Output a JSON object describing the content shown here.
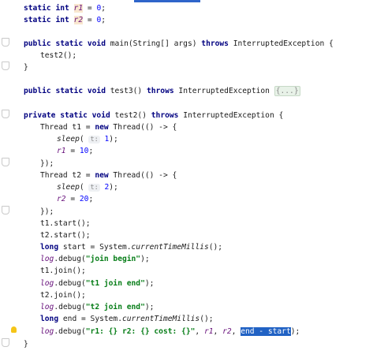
{
  "editor": {
    "lines": [
      {
        "id": "l1",
        "parts": [
          [
            "kw",
            "static "
          ],
          [
            "kw",
            "int "
          ],
          [
            "field hl-write",
            "r1"
          ],
          [
            "type",
            " = "
          ],
          [
            "num",
            "0"
          ],
          [
            "type",
            ";"
          ]
        ]
      },
      {
        "id": "l2",
        "parts": [
          [
            "kw",
            "static "
          ],
          [
            "kw",
            "int "
          ],
          [
            "field hl-write",
            "r2"
          ],
          [
            "type",
            " = "
          ],
          [
            "num",
            "0"
          ],
          [
            "type",
            ";"
          ]
        ]
      },
      {
        "id": "l3",
        "parts": []
      },
      {
        "id": "l4",
        "parts": [
          [
            "kw",
            "public "
          ],
          [
            "kw",
            "static "
          ],
          [
            "kw",
            "void "
          ],
          [
            "type",
            "main(String[] args) "
          ],
          [
            "kw",
            "throws "
          ],
          [
            "type",
            "InterruptedException {"
          ]
        ]
      },
      {
        "id": "l5",
        "parts": [
          [
            "type",
            "test2();"
          ]
        ]
      },
      {
        "id": "l6",
        "parts": [
          [
            "type",
            "}"
          ]
        ]
      },
      {
        "id": "l7",
        "parts": []
      },
      {
        "id": "l8",
        "parts": [
          [
            "kw",
            "public "
          ],
          [
            "kw",
            "static "
          ],
          [
            "kw",
            "void "
          ],
          [
            "type",
            "test3() "
          ],
          [
            "kw",
            "throws "
          ],
          [
            "type",
            "InterruptedException "
          ],
          [
            "fold",
            "{...}"
          ]
        ]
      },
      {
        "id": "l9",
        "parts": []
      },
      {
        "id": "l10",
        "parts": [
          [
            "kw",
            "private "
          ],
          [
            "kw",
            "static "
          ],
          [
            "kw",
            "void "
          ],
          [
            "type",
            "test2() "
          ],
          [
            "kw",
            "throws "
          ],
          [
            "type",
            "InterruptedException {"
          ]
        ]
      },
      {
        "id": "l11",
        "parts": [
          [
            "type",
            "Thread t1 = "
          ],
          [
            "kw",
            "new "
          ],
          [
            "type",
            "Thread(() -> {"
          ]
        ]
      },
      {
        "id": "l12",
        "parts": [
          [
            "method-static",
            "sleep"
          ],
          [
            "type",
            "( "
          ],
          [
            "hint",
            "t:"
          ],
          [
            "type",
            " "
          ],
          [
            "num",
            "1"
          ],
          [
            "type",
            ");"
          ]
        ]
      },
      {
        "id": "l13",
        "parts": [
          [
            "field",
            "r1"
          ],
          [
            "type",
            " = "
          ],
          [
            "num",
            "10"
          ],
          [
            "type",
            ";"
          ]
        ]
      },
      {
        "id": "l14",
        "parts": [
          [
            "type",
            "});"
          ]
        ]
      },
      {
        "id": "l15",
        "parts": [
          [
            "type",
            "Thread t2 = "
          ],
          [
            "kw",
            "new "
          ],
          [
            "type",
            "Thread(() -> {"
          ]
        ]
      },
      {
        "id": "l16",
        "parts": [
          [
            "method-static",
            "sleep"
          ],
          [
            "type",
            "( "
          ],
          [
            "hint",
            "t:"
          ],
          [
            "type",
            " "
          ],
          [
            "num",
            "2"
          ],
          [
            "type",
            ");"
          ]
        ]
      },
      {
        "id": "l17",
        "parts": [
          [
            "field",
            "r2"
          ],
          [
            "type",
            " = "
          ],
          [
            "num",
            "20"
          ],
          [
            "type",
            ";"
          ]
        ]
      },
      {
        "id": "l18",
        "parts": [
          [
            "type",
            "});"
          ]
        ]
      },
      {
        "id": "l19",
        "parts": [
          [
            "type",
            "t1.start();"
          ]
        ]
      },
      {
        "id": "l20",
        "parts": [
          [
            "type",
            "t2.start();"
          ]
        ]
      },
      {
        "id": "l21",
        "parts": [
          [
            "kw",
            "long "
          ],
          [
            "type",
            "start = System."
          ],
          [
            "method-static",
            "currentTimeMillis"
          ],
          [
            "type",
            "();"
          ]
        ]
      },
      {
        "id": "l22",
        "parts": [
          [
            "log",
            "log"
          ],
          [
            "type",
            ".debug("
          ],
          [
            "str",
            "\"join begin\""
          ],
          [
            "type",
            ");"
          ]
        ]
      },
      {
        "id": "l23",
        "parts": [
          [
            "type",
            "t1.join();"
          ]
        ]
      },
      {
        "id": "l24",
        "parts": [
          [
            "log",
            "log"
          ],
          [
            "type",
            ".debug("
          ],
          [
            "str",
            "\"t1 join end\""
          ],
          [
            "type",
            ");"
          ]
        ]
      },
      {
        "id": "l25",
        "parts": [
          [
            "type",
            "t2.join();"
          ]
        ]
      },
      {
        "id": "l26",
        "parts": [
          [
            "log",
            "log"
          ],
          [
            "type",
            ".debug("
          ],
          [
            "str",
            "\"t2 join end\""
          ],
          [
            "type",
            ");"
          ]
        ]
      },
      {
        "id": "l27",
        "parts": [
          [
            "kw",
            "long "
          ],
          [
            "type",
            "end = System."
          ],
          [
            "method-static",
            "currentTimeMillis"
          ],
          [
            "type",
            "();"
          ]
        ]
      },
      {
        "id": "l28",
        "parts": [
          [
            "log",
            "log"
          ],
          [
            "type",
            ".debug("
          ],
          [
            "str",
            "\"r1: {} r2: {} cost: {}\""
          ],
          [
            "type",
            ", "
          ],
          [
            "field",
            "r1"
          ],
          [
            "type",
            ", "
          ],
          [
            "field",
            "r2"
          ],
          [
            "type",
            ", "
          ],
          [
            "sel",
            "end - start"
          ],
          [
            "type",
            ");"
          ]
        ]
      },
      {
        "id": "l29",
        "parts": [
          [
            "type",
            "}"
          ]
        ]
      }
    ]
  },
  "colors": {
    "keyword": "#000080",
    "string": "#067d17",
    "number": "#0000ff",
    "field": "#660e7a",
    "selection": "#2162c4"
  },
  "icons": [
    "lightbulb-icon",
    "fold-marker-icon"
  ]
}
